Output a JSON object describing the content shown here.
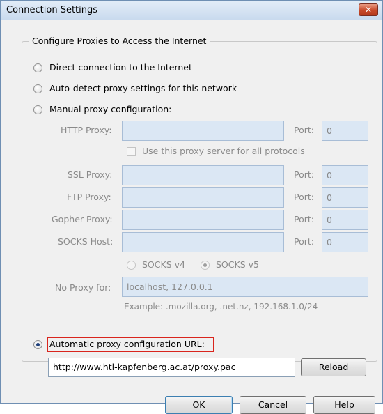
{
  "window": {
    "title": "Connection Settings",
    "close_glyph": "✕"
  },
  "group": {
    "label": "Configure Proxies to Access the Internet"
  },
  "modes": {
    "direct": "Direct connection to the Internet",
    "auto_detect": "Auto-detect proxy settings for this network",
    "manual": "Manual proxy configuration:",
    "auto_url": "Automatic proxy configuration URL:",
    "selected": "auto_url"
  },
  "http": {
    "label": "HTTP Proxy:",
    "host": "",
    "port_label": "Port:",
    "port": "0"
  },
  "share": {
    "label": "Use this proxy server for all protocols",
    "checked": false
  },
  "ssl": {
    "label": "SSL Proxy:",
    "host": "",
    "port_label": "Port:",
    "port": "0"
  },
  "ftp": {
    "label": "FTP Proxy:",
    "host": "",
    "port_label": "Port:",
    "port": "0"
  },
  "gopher": {
    "label": "Gopher Proxy:",
    "host": "",
    "port_label": "Port:",
    "port": "0"
  },
  "socks": {
    "label": "SOCKS Host:",
    "host": "",
    "port_label": "Port:",
    "port": "0",
    "v4_label": "SOCKS v4",
    "v5_label": "SOCKS v5",
    "version_selected": "v5"
  },
  "no_proxy": {
    "label": "No Proxy for:",
    "value": "localhost, 127.0.0.1",
    "example": "Example: .mozilla.org, .net.nz, 192.168.1.0/24"
  },
  "auto_config": {
    "url": "http://www.htl-kapfenberg.ac.at/proxy.pac",
    "reload_label": "Reload"
  },
  "buttons": {
    "ok": "OK",
    "cancel": "Cancel",
    "help": "Help"
  }
}
